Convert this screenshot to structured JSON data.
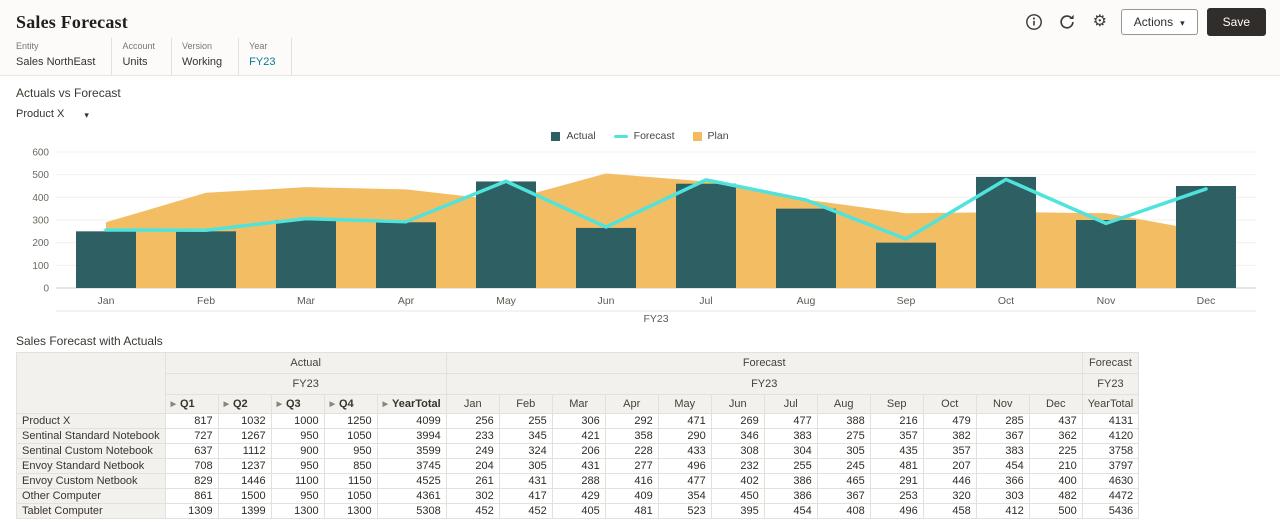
{
  "header": {
    "title": "Sales Forecast",
    "actions_label": "Actions",
    "save_label": "Save",
    "toolbar_icons": [
      "info-icon",
      "refresh-icon",
      "gear-icon"
    ]
  },
  "pov": {
    "items": [
      {
        "label": "Entity",
        "value": "Sales NorthEast",
        "highlighted": false
      },
      {
        "label": "Account",
        "value": "Units",
        "highlighted": false
      },
      {
        "label": "Version",
        "value": "Working",
        "highlighted": false
      },
      {
        "label": "Year",
        "value": "FY23",
        "highlighted": true
      }
    ],
    "highlight_color": "#0d7a93"
  },
  "chart_section": {
    "title": "Actuals vs Forecast",
    "product_selector": "Product X"
  },
  "chart_data": {
    "type": "combo",
    "title": "Actuals vs Forecast",
    "categories": [
      "Jan",
      "Feb",
      "Mar",
      "Apr",
      "May",
      "Jun",
      "Jul",
      "Aug",
      "Sep",
      "Oct",
      "Nov",
      "Dec"
    ],
    "group_label": "FY23",
    "ylim": [
      0,
      600
    ],
    "yticks": [
      0,
      100,
      200,
      300,
      400,
      500,
      600
    ],
    "legend_position": "top-center",
    "grid": "light",
    "series": [
      {
        "name": "Actual",
        "type": "bar",
        "color": "#2e5f63",
        "values": [
          250,
          250,
          300,
          290,
          470,
          265,
          460,
          350,
          200,
          490,
          300,
          450
        ]
      },
      {
        "name": "Forecast",
        "type": "line",
        "color": "#4fe3dc",
        "values": [
          256,
          255,
          306,
          292,
          471,
          269,
          477,
          388,
          216,
          479,
          285,
          437
        ]
      },
      {
        "name": "Plan",
        "type": "area",
        "color": "#f3ba5e",
        "values": [
          290,
          420,
          445,
          435,
          385,
          505,
          470,
          390,
          330,
          335,
          330,
          250
        ]
      }
    ]
  },
  "table_section": {
    "title": "Sales Forecast with Actuals",
    "scenario_groups": [
      {
        "label": "Actual",
        "span": 5
      },
      {
        "label": "Forecast",
        "span": 12
      },
      {
        "label": "Forecast",
        "span": 1
      }
    ],
    "year_groups": [
      {
        "label": "FY23",
        "span": 5
      },
      {
        "label": "FY23",
        "span": 12
      },
      {
        "label": "FY23",
        "span": 1
      }
    ],
    "columns": [
      {
        "label": "Q1",
        "expandable": true
      },
      {
        "label": "Q2",
        "expandable": true
      },
      {
        "label": "Q3",
        "expandable": true
      },
      {
        "label": "Q4",
        "expandable": true
      },
      {
        "label": "YearTotal",
        "expandable": true
      },
      {
        "label": "Jan",
        "expandable": false
      },
      {
        "label": "Feb",
        "expandable": false
      },
      {
        "label": "Mar",
        "expandable": false
      },
      {
        "label": "Apr",
        "expandable": false
      },
      {
        "label": "May",
        "expandable": false
      },
      {
        "label": "Jun",
        "expandable": false
      },
      {
        "label": "Jul",
        "expandable": false
      },
      {
        "label": "Aug",
        "expandable": false
      },
      {
        "label": "Sep",
        "expandable": false
      },
      {
        "label": "Oct",
        "expandable": false
      },
      {
        "label": "Nov",
        "expandable": false
      },
      {
        "label": "Dec",
        "expandable": false
      },
      {
        "label": "YearTotal",
        "expandable": false
      }
    ],
    "rows": [
      {
        "label": "Product X",
        "values": [
          817,
          1032,
          1000,
          1250,
          4099,
          256,
          255,
          306,
          292,
          471,
          269,
          477,
          388,
          216,
          479,
          285,
          437,
          4131
        ]
      },
      {
        "label": "Sentinal Standard Notebook",
        "values": [
          727,
          1267,
          950,
          1050,
          3994,
          233,
          345,
          421,
          358,
          290,
          346,
          383,
          275,
          357,
          382,
          367,
          362,
          4120
        ]
      },
      {
        "label": "Sentinal Custom Notebook",
        "values": [
          637,
          1112,
          900,
          950,
          3599,
          249,
          324,
          206,
          228,
          433,
          308,
          304,
          305,
          435,
          357,
          383,
          225,
          3758
        ]
      },
      {
        "label": "Envoy Standard Netbook",
        "values": [
          708,
          1237,
          950,
          850,
          3745,
          204,
          305,
          431,
          277,
          496,
          232,
          255,
          245,
          481,
          207,
          454,
          210,
          3797
        ]
      },
      {
        "label": "Envoy Custom Netbook",
        "values": [
          829,
          1446,
          1100,
          1150,
          4525,
          261,
          431,
          288,
          416,
          477,
          402,
          386,
          465,
          291,
          446,
          366,
          400,
          4630
        ]
      },
      {
        "label": "Other Computer",
        "values": [
          861,
          1500,
          950,
          1050,
          4361,
          302,
          417,
          429,
          409,
          354,
          450,
          386,
          367,
          253,
          320,
          303,
          482,
          4472
        ]
      },
      {
        "label": "Tablet Computer",
        "values": [
          1309,
          1399,
          1300,
          1300,
          5308,
          452,
          452,
          405,
          481,
          523,
          395,
          454,
          408,
          496,
          458,
          412,
          500,
          5436
        ]
      }
    ]
  },
  "colors": {
    "save_button_bg": "#312d2a",
    "accent_teal": "#0d7a93",
    "actual_bar": "#2e5f63",
    "forecast_line": "#4fe3dc",
    "plan_area": "#f3ba5e",
    "header_bg": "#fcfbfa"
  }
}
